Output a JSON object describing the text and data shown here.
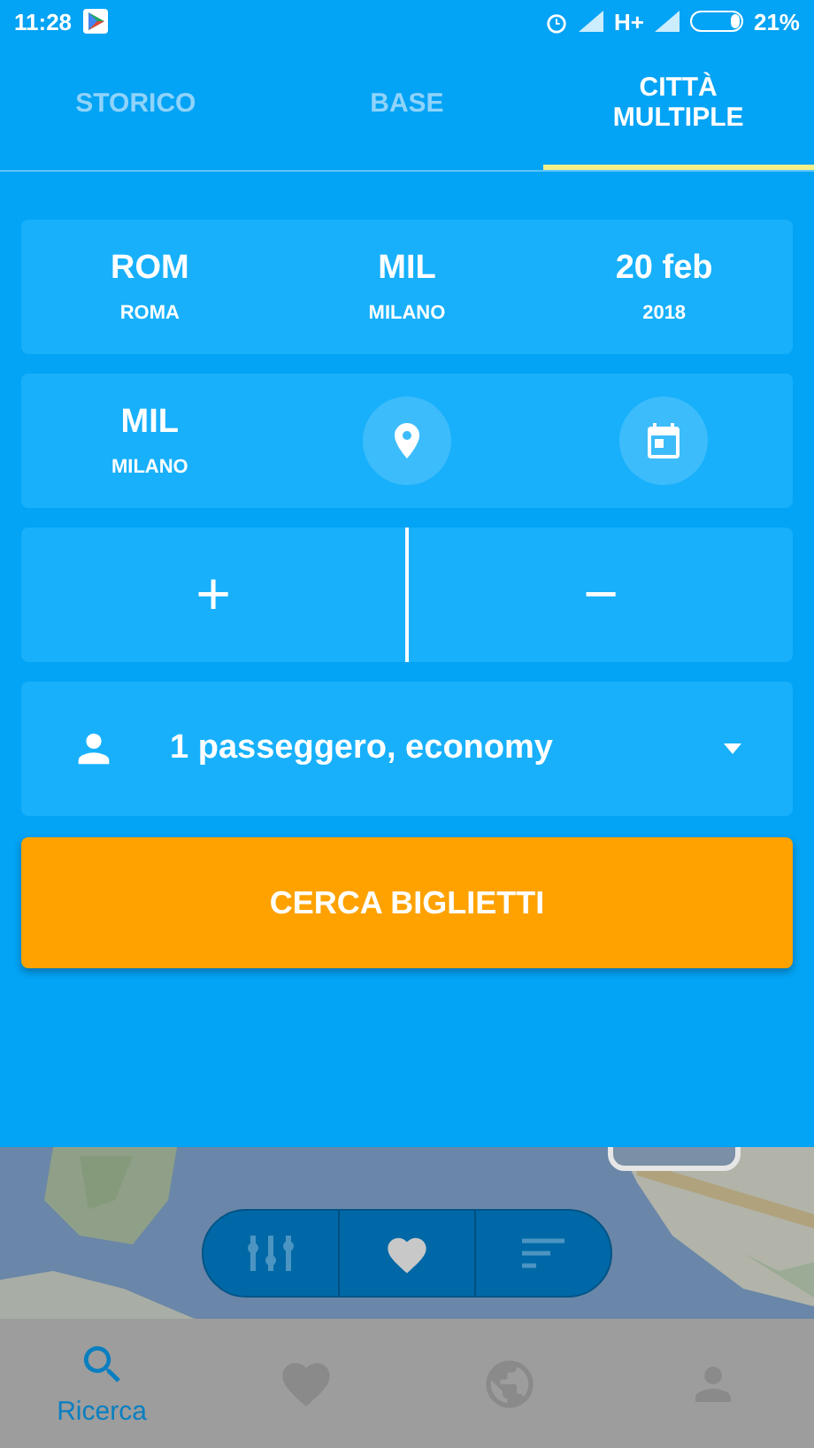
{
  "status_bar": {
    "time": "11:28",
    "network": "H+",
    "battery": "21%"
  },
  "tabs": [
    {
      "label": "STORICO",
      "selected": false
    },
    {
      "label": "BASE",
      "selected": false
    },
    {
      "label": "CITTÀ MULTIPLE",
      "selected": true
    }
  ],
  "legs": [
    {
      "cells": [
        {
          "kind": "text",
          "main": "ROM",
          "sub": "ROMA"
        },
        {
          "kind": "text",
          "main": "MIL",
          "sub": "MILANO"
        },
        {
          "kind": "text",
          "main": "20 feb",
          "sub": "2018"
        }
      ]
    },
    {
      "cells": [
        {
          "kind": "text",
          "main": "MIL",
          "sub": "MILANO"
        },
        {
          "kind": "pin"
        },
        {
          "kind": "calendar"
        }
      ]
    }
  ],
  "leg_controls": {
    "add": "+",
    "remove": "−"
  },
  "passengers": {
    "label": "1 passeggero, economy"
  },
  "search_button": "CERCA BIGLIETTI",
  "bottom_nav": [
    {
      "kind": "search",
      "label": "Ricerca",
      "selected": true
    },
    {
      "kind": "heart",
      "selected": false
    },
    {
      "kind": "globe",
      "selected": false
    },
    {
      "kind": "person",
      "selected": false
    }
  ]
}
